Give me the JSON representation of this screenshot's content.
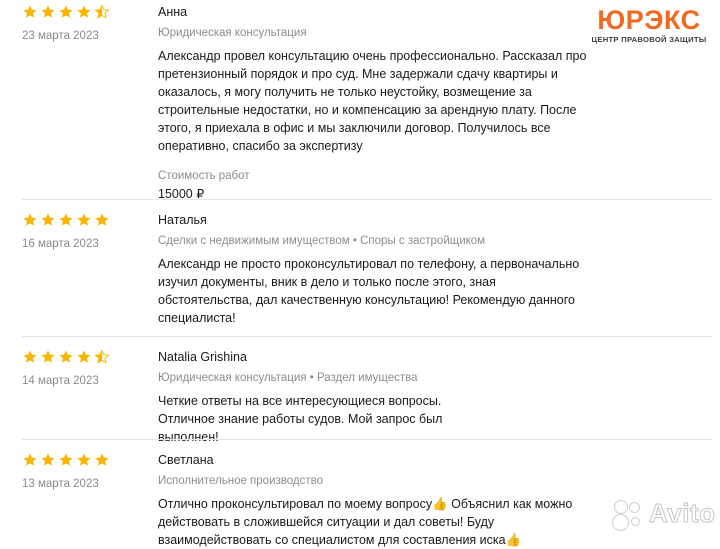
{
  "brand": {
    "logo_main": "ЮРЭКС",
    "logo_sub": "ЦЕНТР ПРАВОВОЙ ЗАЩИТЫ",
    "accent_color": "#f26a21",
    "watermark": "Avito"
  },
  "star_color": "#f7b500",
  "reviews": [
    {
      "rating": 4.5,
      "author": "Анна",
      "date": "23 марта 2023",
      "category": "Юридическая консультация",
      "text": "Александр провел консультацию очень профессионально. Рассказал про претензионный порядок и про суд. Мне задержали сдачу квартиры и оказалось, я могу получить не только неустойку, возмещение за строительные недостатки, но и компенсацию за арендную плату. После этого, я приехала в офис и мы заключили договор. Получилось все оперативно, спасибо за экспертизу",
      "cost_label": "Стоимость работ",
      "cost_value": "15000 ₽"
    },
    {
      "rating": 5,
      "author": "Наталья",
      "date": "16 марта 2023",
      "category": "Сделки с недвижимым имуществом • Споры с застройщиком",
      "text": "Александр не просто проконсультировал по телефону, а первоначально изучил документы, вник в дело и только после этого, зная обстоятельства, дал качественную консультацию! Рекомендую данного специалиста!"
    },
    {
      "rating": 4.5,
      "author": "Natalia Grishina",
      "date": "14 марта 2023",
      "category": "Юридическая консультация • Раздел имущества",
      "text": "Четкие ответы на все интересующиеся вопросы. Отличное знание работы судов. Мой запрос был выполнен!"
    },
    {
      "rating": 5,
      "author": "Светлана",
      "date": "13 марта 2023",
      "category": "Исполнительное производство",
      "text": "Отлично проконсультировал по моему вопросу👍 Объяснил как можно действовать в сложившейся ситуации и дал советы! Буду взаимодействовать со специалистом для составления иска👍"
    }
  ]
}
